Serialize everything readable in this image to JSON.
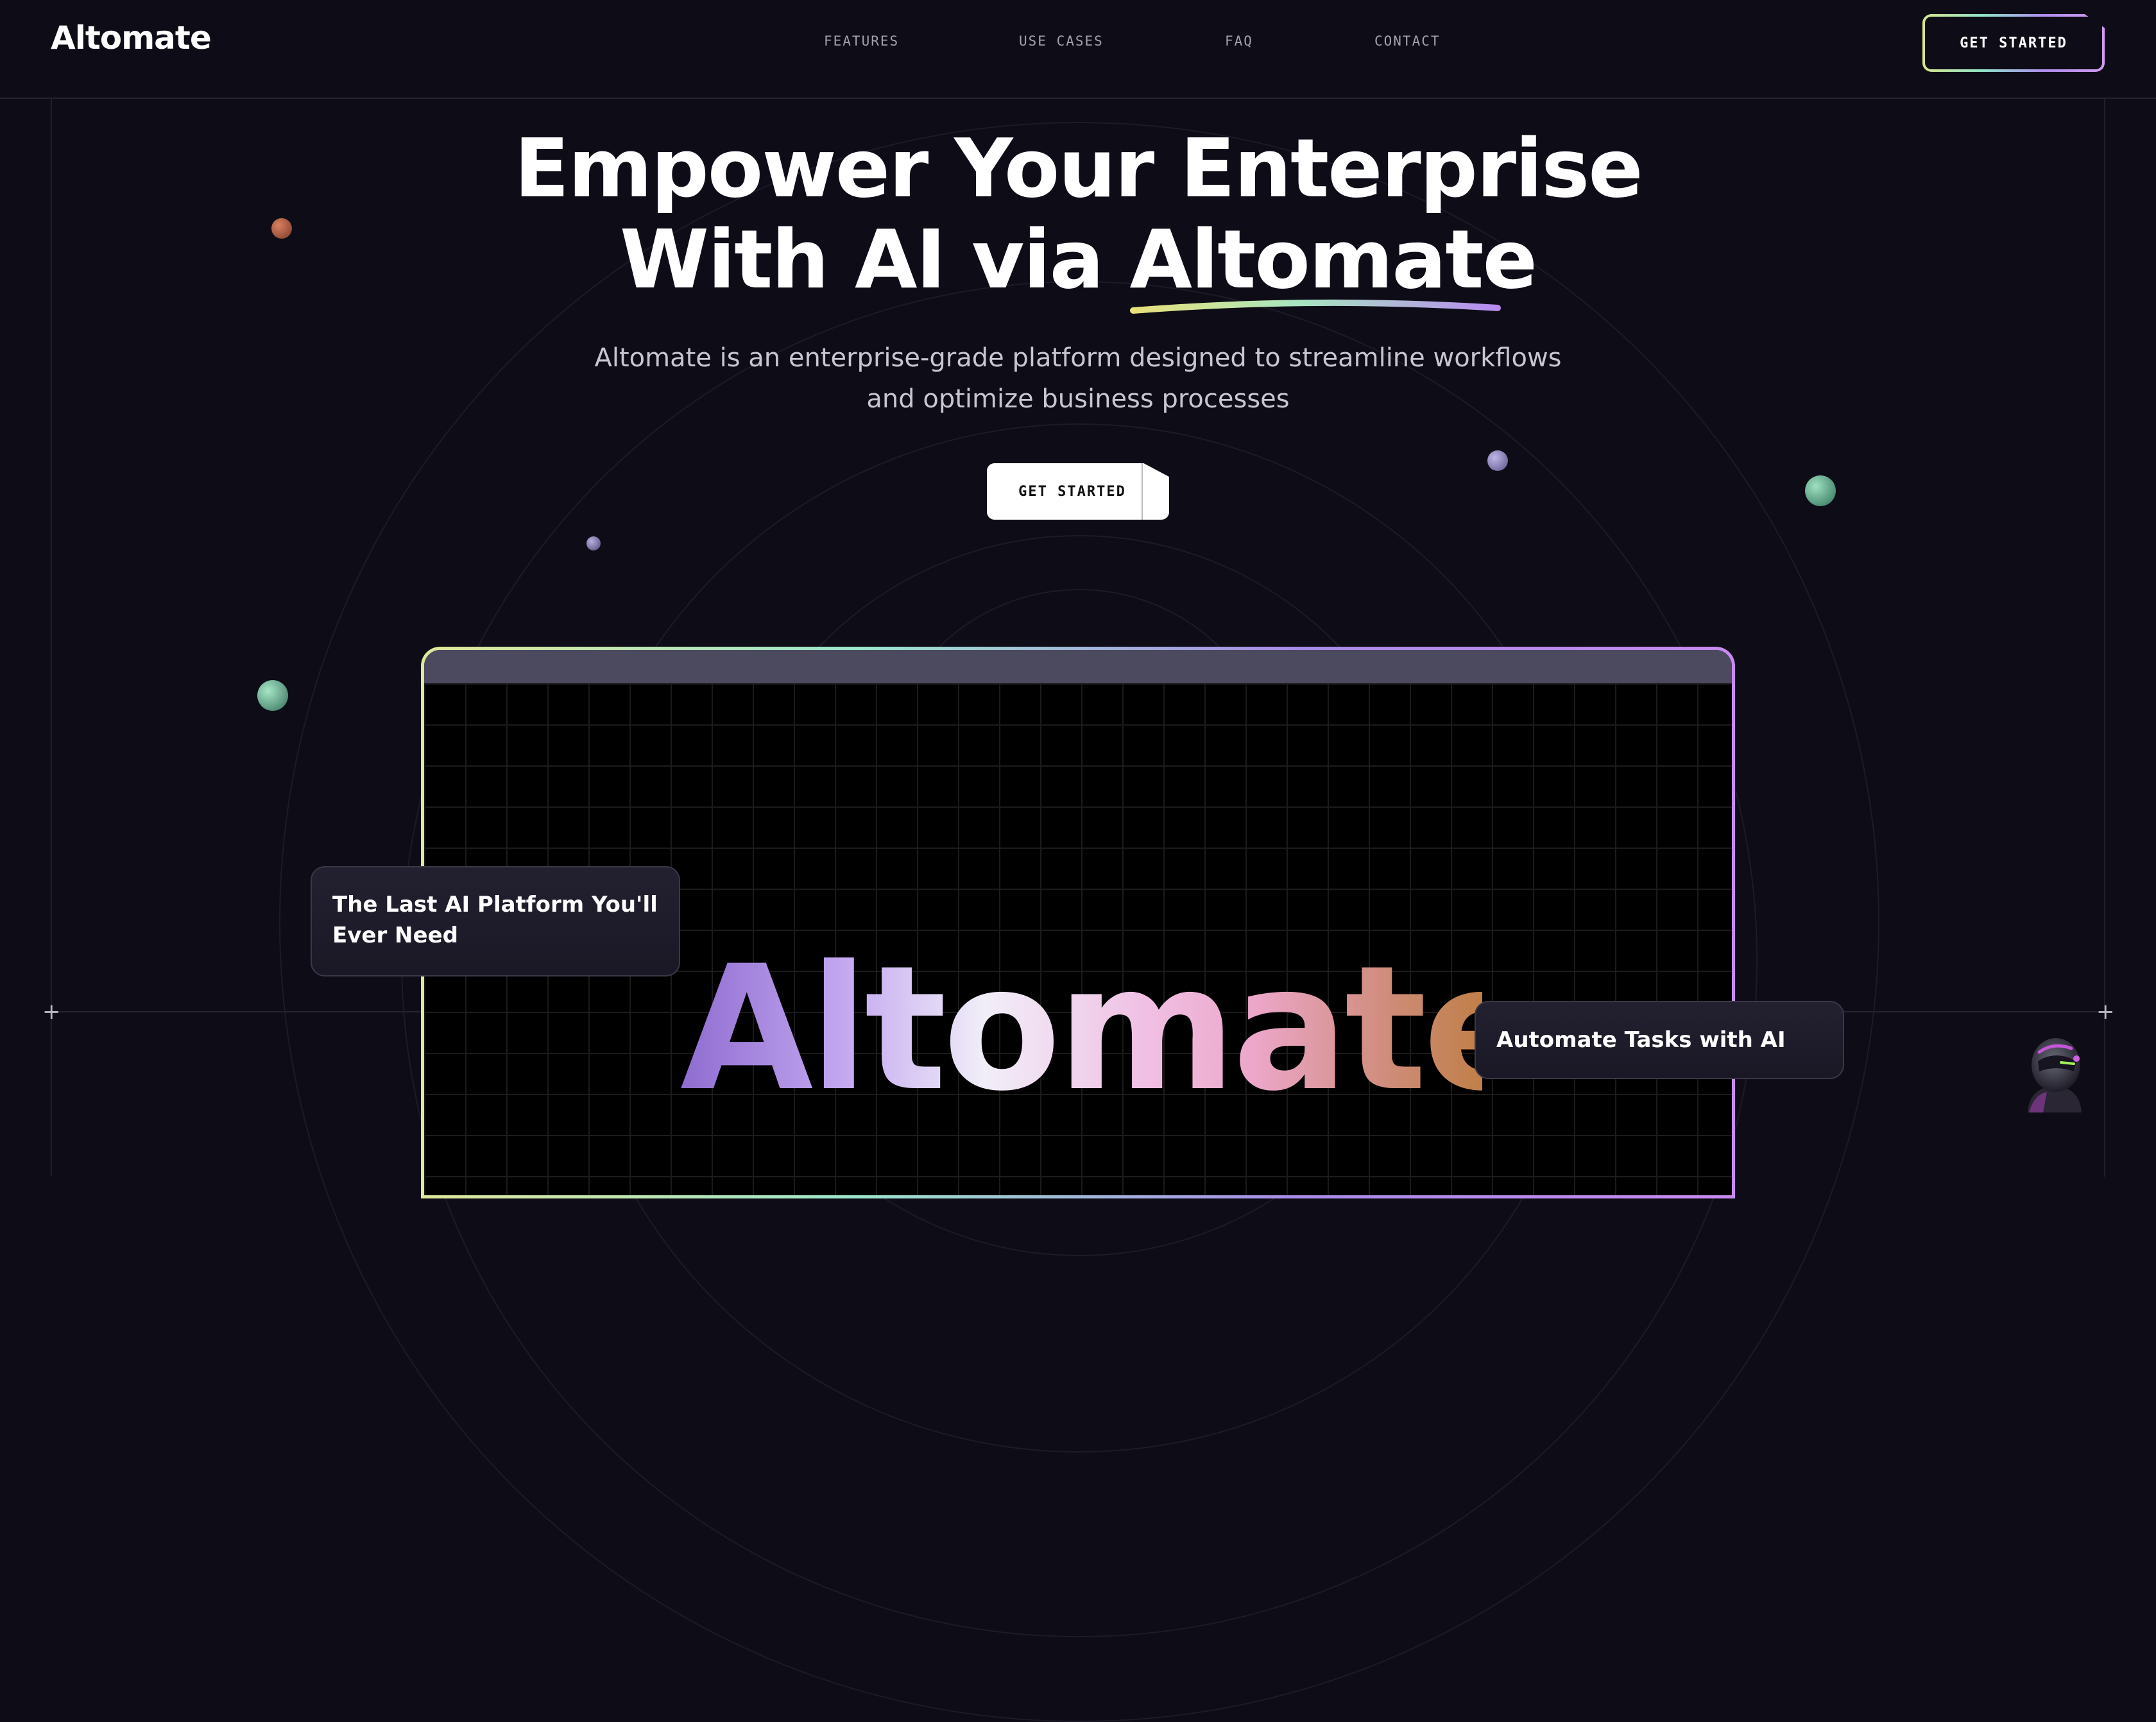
{
  "brand": {
    "name": "Altomate"
  },
  "nav": {
    "items": [
      "FEATURES",
      "USE CASES",
      "FAQ",
      "CONTACT"
    ],
    "cta": "GET STARTED"
  },
  "hero": {
    "title_line1": "Empower Your Enterprise",
    "title_line2_prefix": "With AI via ",
    "title_line2_highlight": "Altomate",
    "subtitle_line1": "Altomate is an enterprise-grade platform designed to streamline workflows",
    "subtitle_line2": "and optimize business processes",
    "cta": "GET STARTED"
  },
  "showcase": {
    "big_word": "Altomate",
    "card_left": "The Last AI Platform You'll Ever Need",
    "card_right": "Automate Tasks with AI"
  },
  "icons": {
    "plus_left": "plus-icon",
    "plus_right": "plus-icon",
    "avatar": "robot-avatar-icon"
  },
  "colors": {
    "background": "#0e0c16",
    "gradient_start": "#dfe79a",
    "gradient_mid": "#9be6cc",
    "gradient_end": "#c88af0"
  }
}
